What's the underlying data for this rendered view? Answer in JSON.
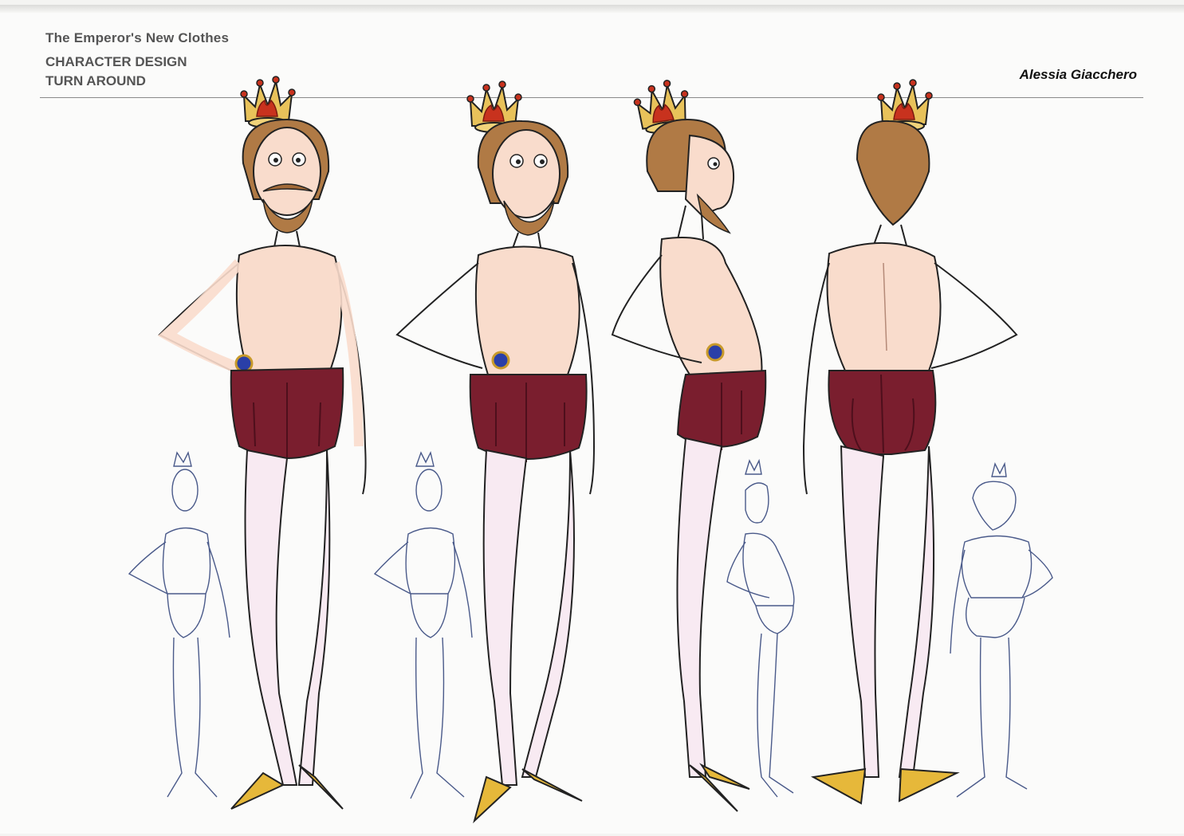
{
  "header": {
    "title": "The Emperor's New Clothes",
    "subtitle_line1": "CHARACTER DESIGN",
    "subtitle_line2": "TURN AROUND",
    "artist": "Alessia Giacchero"
  },
  "colors": {
    "paper": "#fbfbfa",
    "skin": "#f9dccc",
    "hair": "#b07a45",
    "shorts": "#7a1e2e",
    "tights": "#f8eaf2",
    "crown_gold": "#e8c25a",
    "crown_red": "#c8321e",
    "shoe_gold": "#e6b83a",
    "ring_blue": "#2a3fa8",
    "sketch_line": "#4a5a8a"
  },
  "figures": {
    "colored": [
      "front-view",
      "three-quarter-view",
      "side-view",
      "back-view"
    ],
    "sketches": [
      "sketch-front",
      "sketch-three-quarter",
      "sketch-side",
      "sketch-back"
    ]
  }
}
